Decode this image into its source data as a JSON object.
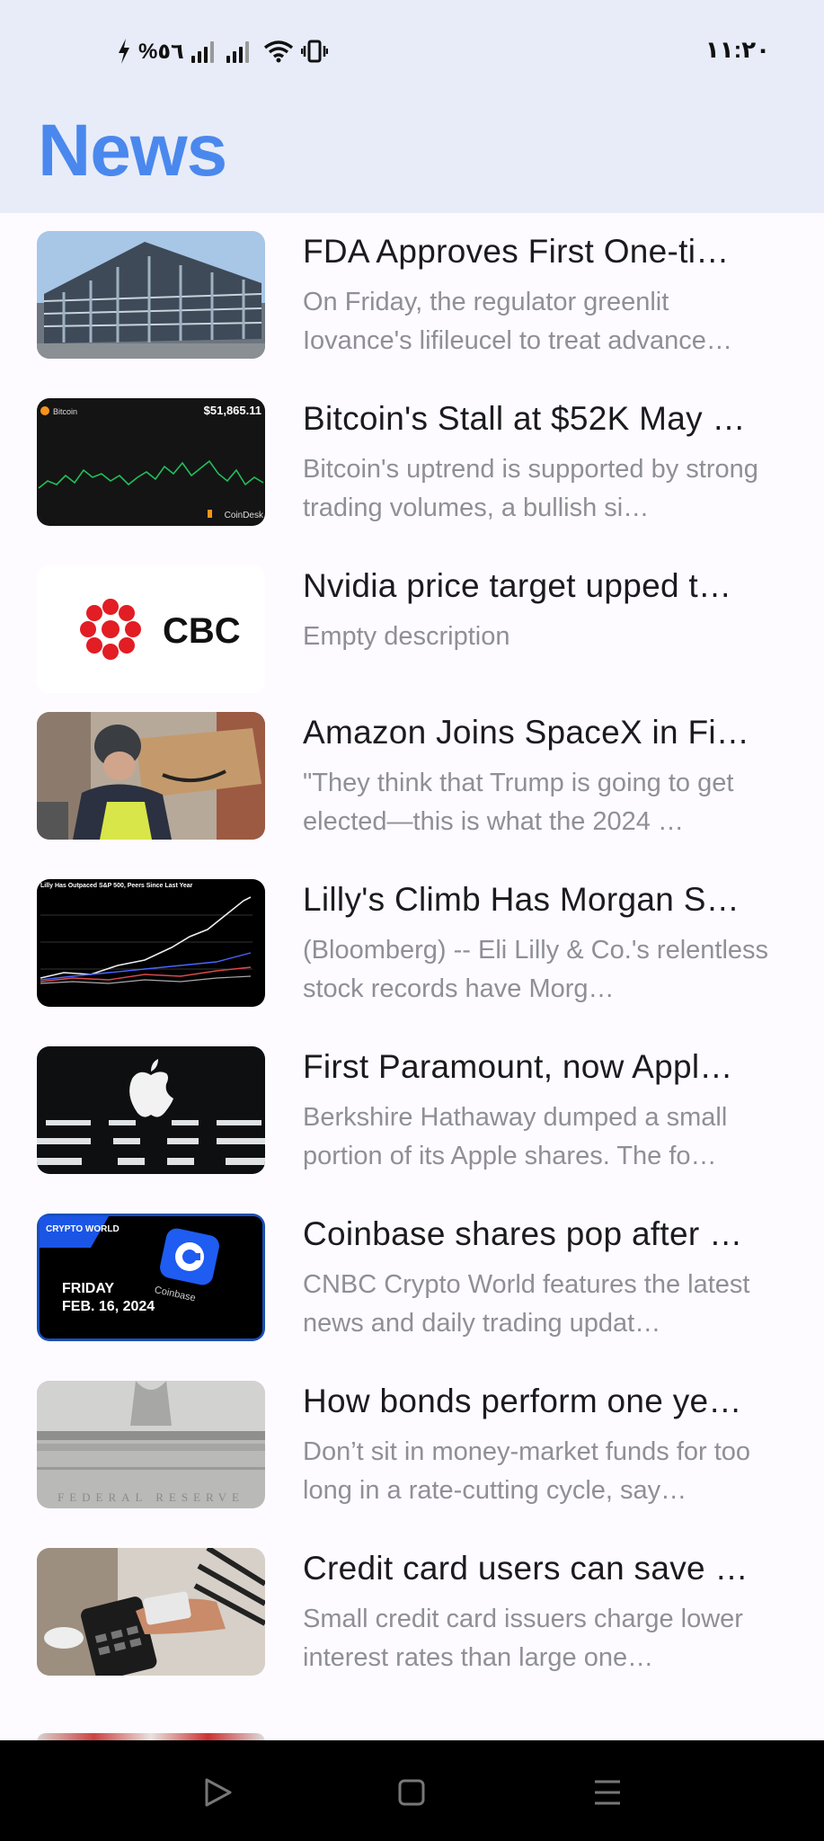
{
  "status_bar": {
    "left_text": "%٥٦",
    "time": "١١:٢٠"
  },
  "header": {
    "title": "News"
  },
  "articles": [
    {
      "headline": "FDA Approves First One-ti…",
      "description": "On Friday, the regulator greenlit Iovance's lifileucel to treat advance…",
      "image": "glass-building-photo"
    },
    {
      "headline": "Bitcoin's Stall at $52K May …",
      "description": "Bitcoin's uptrend is supported by strong trading volumes, a bullish si…",
      "image": "bitcoin-chart-screenshot",
      "image_text": {
        "name": "Bitcoin",
        "price": "$51,865.11",
        "brand": "CoinDesk"
      }
    },
    {
      "headline": "Nvidia price target upped t…",
      "description": "Empty description",
      "image": "cbc-logo",
      "image_text": {
        "logo": "CBC"
      }
    },
    {
      "headline": "Amazon Joins SpaceX in Fi…",
      "description": "\"They think that Trump is going to get elected—this is what the 2024 …",
      "image": "amazon-delivery-photo"
    },
    {
      "headline": "Lilly's Climb Has Morgan S…",
      "description": "(Bloomberg) -- Eli Lilly & Co.'s relentless stock records have Morg…",
      "image": "stock-chart-screenshot",
      "image_text": {
        "caption": "Lilly Has Outpaced S&P 500, Peers Since Last Year"
      }
    },
    {
      "headline": "First Paramount, now Appl…",
      "description": "Berkshire Hathaway dumped a small portion of its Apple shares. The fo…",
      "image": "apple-store-photo"
    },
    {
      "headline": "Coinbase shares pop after …",
      "description": "CNBC Crypto World features the latest news and daily trading updat…",
      "image": "crypto-world-graphic",
      "image_text": {
        "show": "CRYPTO WORLD",
        "day": "FRIDAY",
        "date": "FEB. 16, 2024",
        "brand": "Coinbase"
      }
    },
    {
      "headline": "How bonds perform one ye…",
      "description": "Don’t sit in money-market funds for too long in a rate-cutting cycle, say…",
      "image": "federal-reserve-photo",
      "image_text": {
        "inscription": "FEDERAL RESERVE"
      }
    },
    {
      "headline": "Credit card users can save …",
      "description": "Small credit card issuers charge lower interest rates than large one…",
      "image": "card-payment-photo"
    }
  ],
  "colors": {
    "title": "#4a88ee",
    "header_bg": "#e8ecf8",
    "headline": "#1b1b1f",
    "description": "#8f8f96"
  },
  "nav_bar": {
    "icons": [
      "back-triangle-icon",
      "home-square-icon",
      "menu-lines-icon"
    ]
  }
}
